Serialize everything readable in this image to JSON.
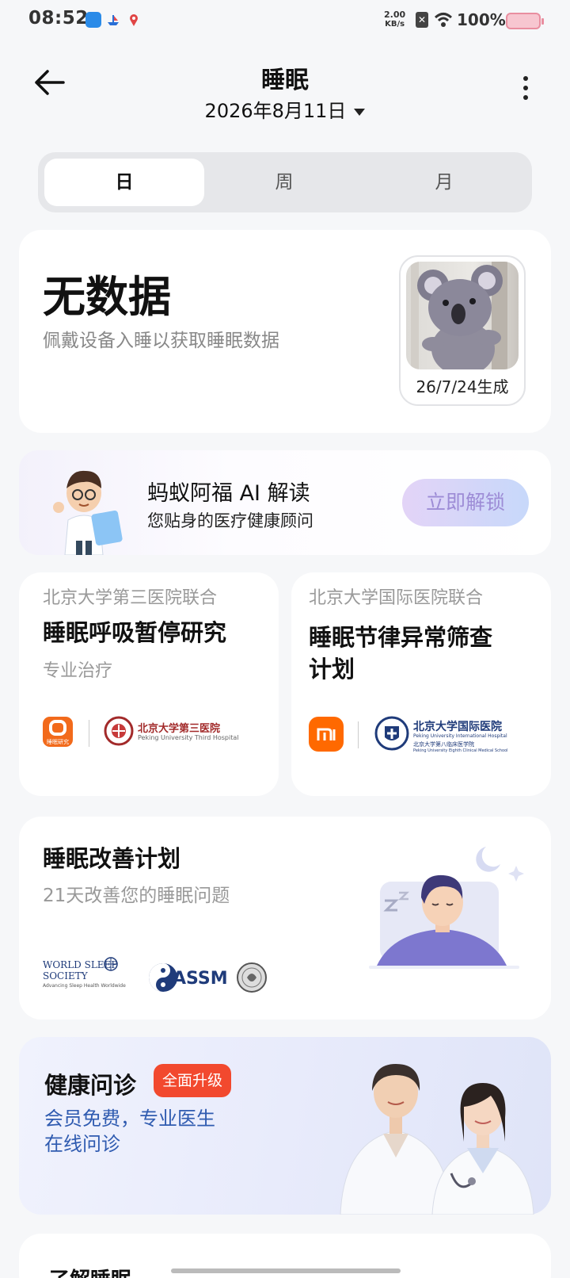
{
  "status_bar": {
    "time": "08:52",
    "net_speed_value": "2.00",
    "net_speed_unit": "KB/s",
    "battery": "100%"
  },
  "header": {
    "title": "睡眠",
    "date": "2026年8月11日"
  },
  "tabs": [
    "日",
    "周",
    "月"
  ],
  "summary": {
    "title": "无数据",
    "subtitle": "佩戴设备入睡以获取睡眠数据",
    "avatar_caption": "26/7/24生成"
  },
  "ai_promo": {
    "title": "蚂蚁阿福 AI 解读",
    "subtitle": "您贴身的医疗健康顾问",
    "button": "立即解锁"
  },
  "research": [
    {
      "org": "北京大学第三医院联合",
      "title": "睡眠呼吸暂停研究",
      "subtitle": "专业治疗",
      "logo_text_app": "睡眠研究",
      "logo_text_org": "北京大学第三医院",
      "logo_text_org_en": "Peking University Third Hospital"
    },
    {
      "org": "北京大学国际医院联合",
      "title": "睡眠节律异常筛查计划",
      "logo_text_org": "北京大学国际医院",
      "logo_text_org_en": "Peking University International Hospital",
      "logo_text_org_en2": "Peking University Eighth Clinical Medical School",
      "logo_text_org2": "北京大学第八临床医学院"
    }
  ],
  "plan": {
    "title": "睡眠改善计划",
    "subtitle": "21天改善您的睡眠问题",
    "partners": [
      "WORLD SLEEP SOCIETY",
      "ASSM"
    ],
    "partner_tagline": "Advancing Sleep Health Worldwide"
  },
  "consult": {
    "title": "健康问诊",
    "badge": "全面升级",
    "subtitle": "会员免费，专业医生在线问诊"
  },
  "learn": {
    "title": "了解睡眠"
  },
  "colors": {
    "accent_red": "#f2492e",
    "link_blue": "#2f5bb0",
    "unlock_purple": "#9d8cd6",
    "mi_orange": "#ff6900"
  }
}
